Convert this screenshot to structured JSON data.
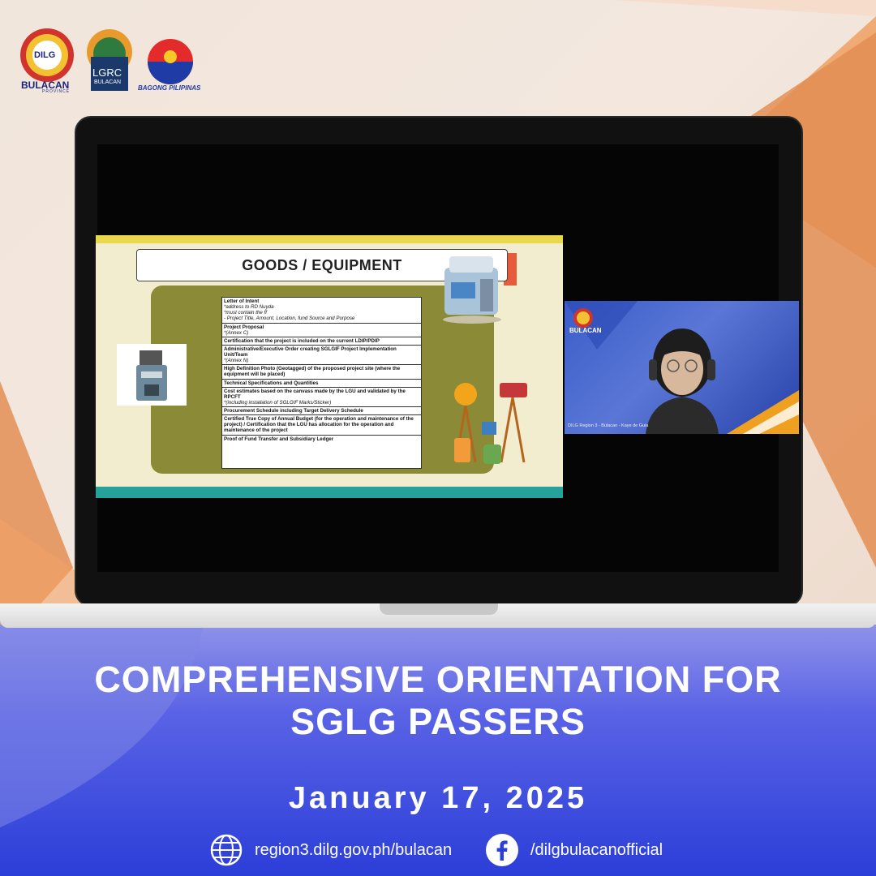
{
  "logos": {
    "dilg": {
      "top": "DILG",
      "bottom": "BULACAN",
      "sub": "PROVINCE"
    },
    "lgrc": {
      "top": "LGRC",
      "bottom": "BULACAN"
    },
    "bagong_pilipinas": "BAGONG PILIPINAS"
  },
  "slide": {
    "title": "GOODS / EQUIPMENT",
    "rows": [
      {
        "label": "Letter of Intent",
        "notes": [
          "*address to RD Nuyda",
          "*must contain the ff",
          "- Project Title, Amount, Location, fund Source and Purpose"
        ]
      },
      {
        "label": "Project Proposal",
        "notes": [
          "*(Annex C)"
        ]
      },
      {
        "label": "Certification that the project is included on the current LDIP/PDIP",
        "notes": []
      },
      {
        "label": "Administrative/Executive Order creating SGLGIF Project Implementation Unit/Team",
        "notes": [
          "*(Annex N)"
        ]
      },
      {
        "label": "High Definition Photo (Geotagged) of the proposed project site (where the equipment will be placed)",
        "notes": []
      },
      {
        "label": "Technical Specifications and Quantities",
        "notes": []
      },
      {
        "label": "Cost estimates based on the canvass made by the LGU and validated by the RPCFT",
        "notes": [
          "*(including installation of SGLGIF Marks/Sticker)"
        ]
      },
      {
        "label": "Procurement Schedule including Target Delivery Schedule",
        "notes": []
      },
      {
        "label": "Certified True Copy of Annual Budget (for the operation and maintenance of the project) / Certification that the LGU has allocation for the operation and maintenance of the project",
        "notes": []
      },
      {
        "label": "Proof of Fund Transfer and Subsidiary Ledger",
        "notes": []
      }
    ]
  },
  "speaker": {
    "logo": "BULACAN",
    "caption": "DILG Region 3 - Bulacan - Kaye de Guia"
  },
  "headline": {
    "line1": "COMPREHENSIVE ORIENTATION FOR",
    "line2": "SGLG PASSERS"
  },
  "date": "January 17, 2025",
  "footer": {
    "website": "region3.dilg.gov.ph/bulacan",
    "facebook": "/dilgbulacanofficial"
  },
  "colors": {
    "accent_blue": "#2b3ed8",
    "accent_orange": "#e0884a",
    "slide_teal": "#25a29a"
  }
}
